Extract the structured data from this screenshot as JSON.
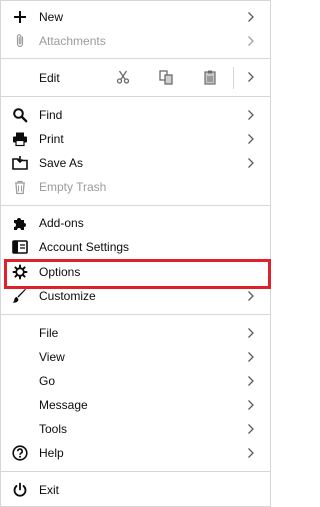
{
  "menu": {
    "new": {
      "label": "New"
    },
    "attachments": {
      "label": "Attachments"
    },
    "edit": {
      "label": "Edit"
    },
    "find": {
      "label": "Find"
    },
    "print": {
      "label": "Print"
    },
    "save_as": {
      "label": "Save As"
    },
    "empty_trash": {
      "label": "Empty Trash"
    },
    "addons": {
      "label": "Add-ons"
    },
    "account_settings": {
      "label": "Account Settings"
    },
    "options": {
      "label": "Options"
    },
    "customize": {
      "label": "Customize"
    },
    "file": {
      "label": "File"
    },
    "view": {
      "label": "View"
    },
    "go": {
      "label": "Go"
    },
    "message": {
      "label": "Message"
    },
    "tools": {
      "label": "Tools"
    },
    "help": {
      "label": "Help"
    },
    "exit": {
      "label": "Exit"
    }
  },
  "colors": {
    "text": "#0c0c0d",
    "disabled_text": "#9b9b9d",
    "separator": "#d7d7db",
    "highlight_border": "#e0202b"
  },
  "icons": {
    "new": "plus-icon",
    "attachments": "paperclip-icon",
    "edit_cut": "scissors-icon",
    "edit_copy": "copy-icon",
    "edit_paste": "clipboard-icon",
    "find": "magnifier-icon",
    "print": "printer-icon",
    "save_as": "save-folder-icon",
    "empty_trash": "trash-icon",
    "addons": "puzzle-icon",
    "account_settings": "account-settings-icon",
    "options": "gear-icon",
    "customize": "paintbrush-icon",
    "help": "question-icon",
    "exit": "power-icon",
    "submenu": "chevron-right-icon"
  }
}
